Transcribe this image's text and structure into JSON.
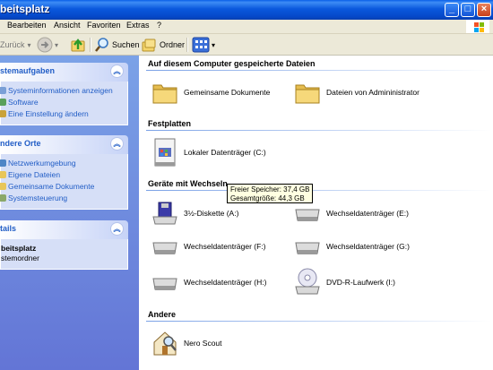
{
  "window": {
    "title": "beitsplatz"
  },
  "menu": [
    "Bearbeiten",
    "Ansicht",
    "Favoriten",
    "Extras",
    "?"
  ],
  "toolbar": {
    "back_label": "Zurück",
    "search_label": "Suchen",
    "folders_label": "Ordner"
  },
  "sidebar": {
    "system_tasks": {
      "title": "stemaufgaben",
      "items": [
        "Systeminformationen anzeigen",
        "Software",
        "Eine Einstellung ändern"
      ]
    },
    "other_places": {
      "title": "ndere Orte",
      "items": [
        "Netzwerkumgebung",
        "Eigene Dateien",
        "Gemeinsame Dokumente",
        "Systemsteuerung"
      ]
    },
    "details": {
      "title": "tails",
      "name": "beitsplatz",
      "type": "stemordner"
    }
  },
  "main": {
    "groups": {
      "stored": "Auf diesem Computer gespeicherte Dateien",
      "harddisks": "Festplatten",
      "removable": "Geräte mit Wechseln",
      "other": "Andere"
    },
    "stored_items": [
      "Gemeinsame Dokumente",
      "Dateien von Admininistrator"
    ],
    "harddisk_items": [
      "Lokaler Datenträger (C:)"
    ],
    "removable_items": [
      "3½-Diskette (A:)",
      "Wechseldatenträger (E:)",
      "Wechseldatenträger (F:)",
      "Wechseldatenträger (G:)",
      "Wechseldatenträger (H:)",
      "DVD-R-Laufwerk (I:)"
    ],
    "other_items": [
      "Nero Scout"
    ]
  },
  "tooltip": {
    "free": "Freier Speicher: 37,4 GB",
    "total": "Gesamtgröße: 44,3 GB"
  },
  "colors": {
    "accent": "#215dc6",
    "titlebar": "#0a58dd",
    "sidebar": "#6b8ce0"
  }
}
